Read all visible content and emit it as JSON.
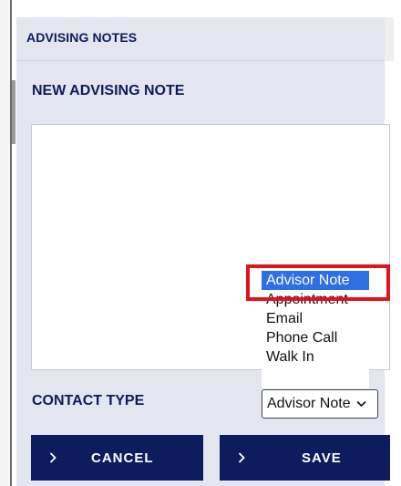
{
  "section": {
    "title": "ADVISING NOTES"
  },
  "form": {
    "title": "NEW ADVISING NOTE",
    "note_text": ""
  },
  "contact_type": {
    "label": "CONTACT TYPE",
    "selected": "Advisor Note",
    "options": [
      "Advisor Note",
      "Appointment",
      "Email",
      "Phone Call",
      "Walk In"
    ],
    "highlighted_option": "Advisor Note"
  },
  "buttons": {
    "cancel": "CANCEL",
    "save": "SAVE"
  },
  "colors": {
    "primary": "#0d1c5c",
    "panel_bg": "#e3e5ef",
    "option_highlight": "#2f6fe4",
    "focus_outline": "#e1131d"
  },
  "icons": {
    "button_icon": "chevron-right-icon",
    "select_icon": "chevron-down-icon"
  }
}
